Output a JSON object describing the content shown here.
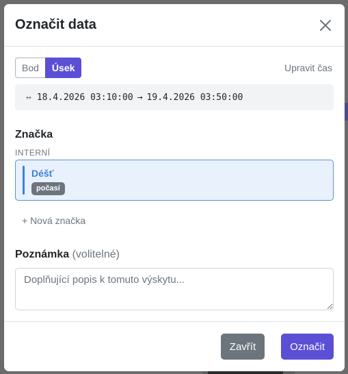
{
  "dialog": {
    "title": "Označit data",
    "mode_point_label": "Bod",
    "mode_range_label": "Úsek",
    "edit_time_label": "Upravit čas",
    "range": {
      "arrow_icon": "↔",
      "start": "18.4.2026 03:10:00",
      "separator": "→",
      "end": "19.4.2026 03:50:00"
    },
    "tag_section_title": "Značka",
    "tag_group_label": "INTERNÍ",
    "selected_tag": {
      "name": "Déšť",
      "category": "počasí",
      "color": "#3b82d8"
    },
    "new_tag_label": "+ Nová značka",
    "note_title": "Poznámka",
    "note_optional": "(volitelné)",
    "note_placeholder": "Doplňující popis k tomuto výskytu...",
    "cancel_label": "Zavřít",
    "submit_label": "Označit",
    "accent_color": "#5b4fd6"
  }
}
